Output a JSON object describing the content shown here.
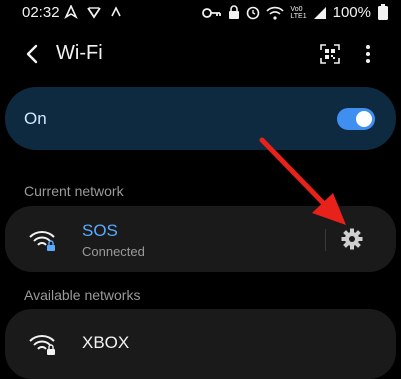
{
  "status_bar": {
    "time": "02:32",
    "battery": "100%",
    "left_icons": [
      "navigation-arrow-icon",
      "v-shaped-icon",
      "caret-icon"
    ],
    "right_icons": [
      "key-icon",
      "lock-icon",
      "alarm-icon",
      "wifi-icon",
      "volte-icon",
      "signal-icon",
      "battery-icon"
    ],
    "volte_top": "Vo0",
    "volte_bottom": "LTE1"
  },
  "header": {
    "title": "Wi-Fi"
  },
  "wifi_toggle": {
    "label": "On",
    "enabled": true,
    "accent": "#3e8ff0"
  },
  "sections": {
    "current": "Current network",
    "available": "Available networks"
  },
  "current_network": {
    "name": "SOS",
    "status": "Connected",
    "name_color": "#5aa9ff"
  },
  "available_networks": [
    {
      "name": "XBOX"
    }
  ],
  "annotation": {
    "arrow_color": "#e8211b"
  }
}
